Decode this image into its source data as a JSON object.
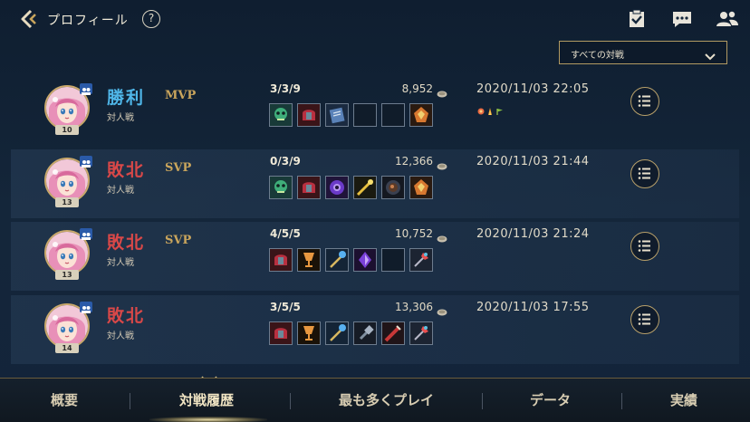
{
  "header": {
    "title": "プロフィール",
    "help": "?",
    "filter": "すべての対戦"
  },
  "matches": [
    {
      "result": "勝利",
      "result_type": "win",
      "rank": "MVP",
      "mode": "対人戦",
      "level": "10",
      "kda": "3/3/9",
      "gold": "8,952",
      "datetime": "2020/11/03 22:05",
      "items": [
        "green-skull",
        "red-helm",
        "blue-book",
        "empty",
        "empty",
        "phoenix-crest"
      ]
    },
    {
      "result": "敗北",
      "result_type": "lose",
      "rank": "SVP",
      "mode": "対人戦",
      "level": "13",
      "kda": "0/3/9",
      "gold": "12,366",
      "datetime": "2020/11/03 21:44",
      "items": [
        "green-skull",
        "red-helm",
        "purple-orb",
        "gold-staff",
        "dark-orb",
        "phoenix-crest"
      ]
    },
    {
      "result": "敗北",
      "result_type": "lose",
      "rank": "SVP",
      "mode": "対人戦",
      "level": "13",
      "kda": "4/5/5",
      "gold": "10,752",
      "datetime": "2020/11/03 21:24",
      "items": [
        "red-helm",
        "gold-goblet",
        "blue-scepter",
        "purple-crystal",
        "empty",
        "feather-wand"
      ]
    },
    {
      "result": "敗北",
      "result_type": "lose",
      "rank": "",
      "mode": "対人戦",
      "level": "14",
      "kda": "3/5/5",
      "gold": "13,306",
      "datetime": "2020/11/03 17:55",
      "items": [
        "red-helm",
        "gold-goblet",
        "blue-scepter",
        "silver-hammer",
        "red-blade",
        "feather-wand"
      ]
    }
  ],
  "nav": [
    {
      "label": "概要"
    },
    {
      "label": "対戦履歴"
    },
    {
      "label": "最も多くプレイ"
    },
    {
      "label": "データ"
    },
    {
      "label": "実績"
    }
  ],
  "colors": {
    "win": "#4fb6e8",
    "lose": "#d94848",
    "gold_accent": "#c9a55c",
    "frame": "#b8a06a"
  }
}
